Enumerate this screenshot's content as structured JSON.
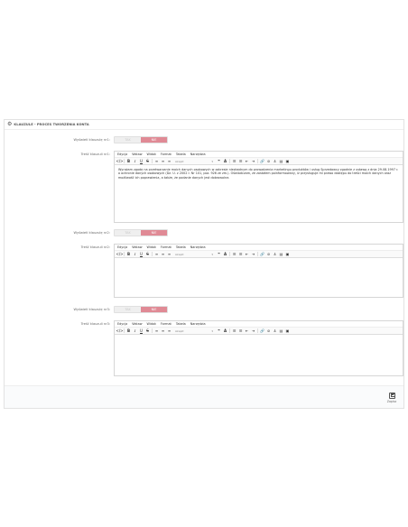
{
  "panel": {
    "icon": "cogs-icon",
    "title": "KLAUZULE - PROCES TWORZENIA KONTA"
  },
  "switch_labels": {
    "off": "TAK",
    "on": "NIE"
  },
  "menu": [
    "Edycja",
    "Wstaw",
    "Widok",
    "Format",
    "Tabela",
    "Narzędzia"
  ],
  "toolbar": {
    "font_placeholder": "Akapit"
  },
  "clauses": [
    {
      "show_label": "Wyświetl klauzulę nr1:",
      "content_label": "Treść klauzuli nr1:",
      "content": "Wyrażam zgodę na przetwarzanie moich danych osobowych w zakresie niezbędnym do prowadzenia marketingu produktów i usług Sprzedawcy zgodnie z ustawą z dnia 29.08.1997 r. o ochronie danych osobowych (Dz. U. z 2002 r. Nr 101, poz. 926 ze zm.). Oświadczam, że zostałem poinformowany, iż przysługuje mi prawo dostępu do treści moich danych oraz możliwość ich poprawienia, a także, że podanie danych jest dobrowolne."
    },
    {
      "show_label": "Wyświetl klauzulę nr2:",
      "content_label": "Treść klauzuli nr2:",
      "content": ""
    },
    {
      "show_label": "Wyświetl klauzulę nr3:",
      "content_label": "Treść klauzuli nr3:",
      "content": ""
    }
  ],
  "footer": {
    "save_label": "Zapisz",
    "save_icon": "floppy-disk-icon"
  }
}
